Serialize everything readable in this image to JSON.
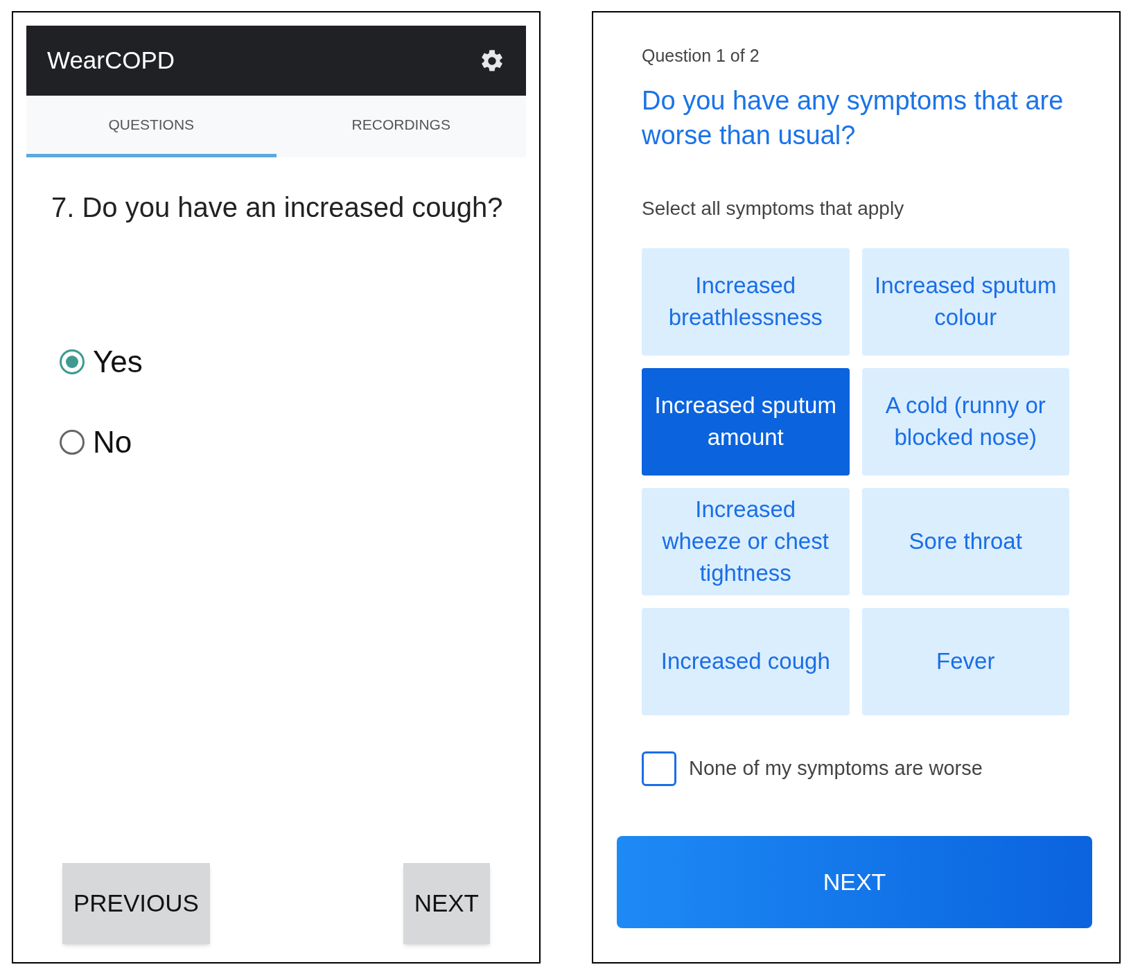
{
  "left_screen": {
    "app_bar": {
      "title": "WearCOPD"
    },
    "tabs": [
      {
        "label": "QUESTIONS",
        "selected": true
      },
      {
        "label": "RECORDINGS",
        "selected": false
      }
    ],
    "question": "7. Do you have an increased cough?",
    "options": [
      {
        "label": "Yes",
        "selected": true
      },
      {
        "label": "No",
        "selected": false
      }
    ],
    "buttons": [
      "PREVIOUS",
      "NEXT"
    ]
  },
  "right_screen": {
    "progress": "Question 1 of 2",
    "title": "Do you have any symptoms that are worse than usual?",
    "instruction": "Select all symptoms that apply",
    "symptoms": [
      {
        "label": "Increased breathlessness",
        "selected": false
      },
      {
        "label": "Increased sputum colour",
        "selected": false
      },
      {
        "label": "Increased sputum amount",
        "selected": true
      },
      {
        "label": "A cold (runny or blocked nose)",
        "selected": false
      },
      {
        "label": "Increased wheeze or chest tightness",
        "selected": false
      },
      {
        "label": "Sore throat",
        "selected": false
      },
      {
        "label": "Increased cough",
        "selected": false
      },
      {
        "label": "Fever",
        "selected": false
      }
    ],
    "none_option": {
      "label": "None of my symptoms are worse",
      "checked": false
    },
    "next_button": "NEXT"
  }
}
